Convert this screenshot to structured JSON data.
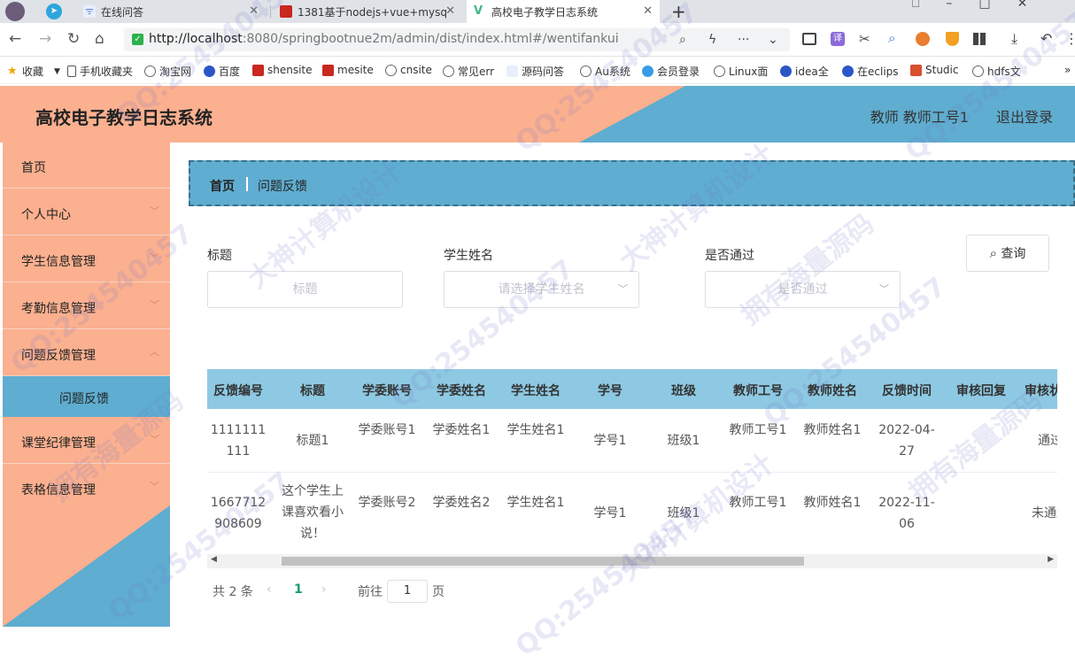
{
  "browser": {
    "tabs": [
      {
        "label": "在线问答"
      },
      {
        "label": "1381基于nodejs+vue+mysq"
      },
      {
        "label": "高校电子教学日志系统"
      }
    ],
    "new_tab": "+",
    "url_host": "http://localhost",
    "url_rest": ":8080/springbootnue2m/admin/dist/index.html#/wentifankui",
    "bookmarks": [
      "收藏",
      "手机收藏夹",
      "淘宝网",
      "百度",
      "shensite",
      "mesite",
      "cnsite",
      "常见err",
      "源码问答",
      "Au系统",
      "会员登录",
      "Linux面",
      "idea全",
      "在eclips",
      "Studic",
      "hdfs文"
    ]
  },
  "header": {
    "title": "高校电子教学日志系统",
    "user": "教师 教师工号1",
    "logout": "退出登录"
  },
  "sidebar": {
    "items": [
      {
        "label": "首页"
      },
      {
        "label": "个人中心"
      },
      {
        "label": "学生信息管理"
      },
      {
        "label": "考勤信息管理"
      },
      {
        "label": "问题反馈管理"
      },
      {
        "label": "问题反馈"
      },
      {
        "label": "课堂纪律管理"
      },
      {
        "label": "表格信息管理"
      }
    ]
  },
  "breadcrumb": {
    "home": "首页",
    "current": "问题反馈"
  },
  "filters": {
    "title_label": "标题",
    "title_placeholder": "标题",
    "student_label": "学生姓名",
    "student_placeholder": "请选择学生姓名",
    "pass_label": "是否通过",
    "pass_placeholder": "是否通过",
    "query": "查询"
  },
  "table": {
    "headers": [
      "反馈编号",
      "标题",
      "学委账号",
      "学委姓名",
      "学生姓名",
      "学号",
      "班级",
      "教师工号",
      "教师姓名",
      "反馈时间",
      "审核回复",
      "审核状态"
    ],
    "rows": [
      [
        "1111111111",
        "标题1",
        "学委账号1",
        "学委姓名1",
        "学生姓名1",
        "学号1",
        "班级1",
        "教师工号1",
        "教师姓名1",
        "2022-04-27",
        "",
        "通过"
      ],
      [
        "1667712908609",
        "这个学生上课喜欢看小说！",
        "学委账号2",
        "学委姓名2",
        "学生姓名1",
        "学号1",
        "班级1",
        "教师工号1",
        "教师姓名1",
        "2022-11-06",
        "",
        "未通过"
      ]
    ]
  },
  "pagination": {
    "total": "共 2 条",
    "current": "1",
    "goto": "前往",
    "page_value": "1",
    "page_unit": "页"
  },
  "watermark": [
    "QQ:254540457",
    "大神计算机设计",
    "拥有海量源码"
  ]
}
